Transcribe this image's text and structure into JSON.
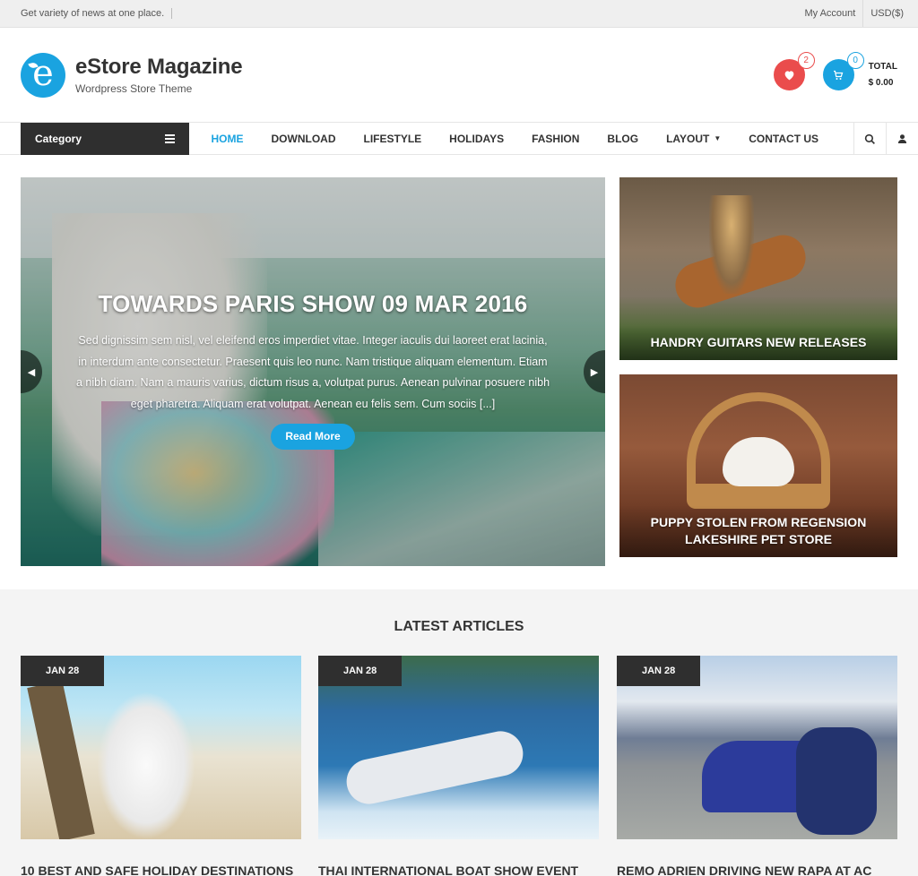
{
  "topbar": {
    "tagline": "Get variety of news at one place.",
    "my_account": "My Account",
    "currency": "USD($)"
  },
  "header": {
    "site_title": "eStore Magazine",
    "site_description": "Wordpress Store Theme",
    "wishlist_count": "2",
    "cart_count": "0",
    "total_label": "TOTAL",
    "total_value": "$ 0.00"
  },
  "nav": {
    "category_label": "Category",
    "items": [
      "HOME",
      "DOWNLOAD",
      "LIFESTYLE",
      "HOLIDAYS",
      "FASHION",
      "BLOG",
      "LAYOUT",
      "CONTACT US"
    ],
    "active": "HOME",
    "icons": [
      "search-icon",
      "user-icon"
    ]
  },
  "slider": {
    "title": "TOWARDS PARIS SHOW 09 MAR 2016",
    "excerpt": "Sed dignissim sem nisl, vel eleifend eros imperdiet vitae. Integer iaculis dui laoreet erat lacinia, in interdum ante consectetur. Praesent quis leo nunc. Nam tristique aliquam elementum. Etiam a nibh diam. Nam a mauris varius, dictum risus a, volutpat purus. Aenean pulvinar posuere nibh eget pharetra. Aliquam erat volutpat. Aenean eu felis sem. Cum sociis [...]",
    "button": "Read More"
  },
  "side_posts": [
    {
      "title": "HANDRY GUITARS NEW RELEASES"
    },
    {
      "title": "PUPPY STOLEN FROM REGENSION LAKESHIRE PET STORE"
    }
  ],
  "latest": {
    "heading": "LATEST ARTICLES",
    "articles": [
      {
        "date": "JAN 28",
        "title": "10 BEST AND SAFE HOLIDAY DESTINATIONS"
      },
      {
        "date": "JAN 28",
        "title": "THAI INTERNATIONAL BOAT SHOW EVENT"
      },
      {
        "date": "JAN 28",
        "title": "REMO ADRIEN DRIVING NEW RAPA AT AC"
      }
    ]
  },
  "colors": {
    "accent": "#1aa3e0",
    "wishlist": "#ea4c4c",
    "dark": "#2f2f2f"
  }
}
